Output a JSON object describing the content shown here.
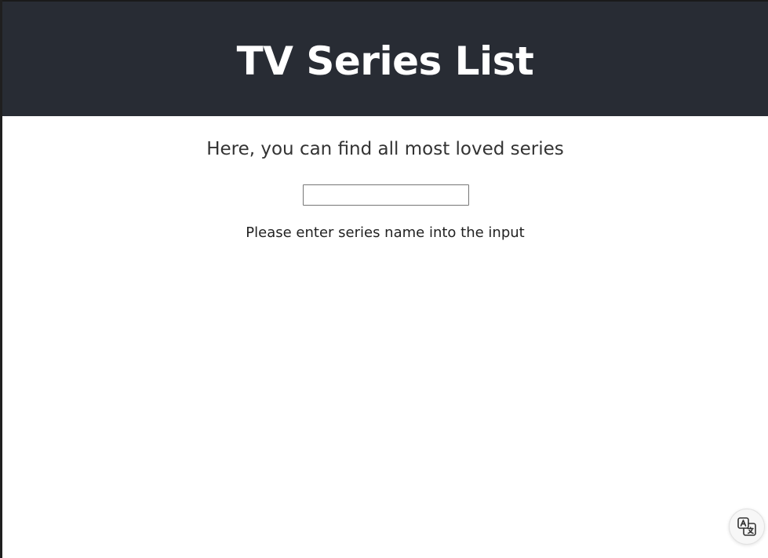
{
  "header": {
    "title": "TV Series List",
    "background_color": "#282c34"
  },
  "main": {
    "subtitle": "Here, you can find all most loved series",
    "search": {
      "value": "",
      "placeholder": ""
    },
    "hint": "Please enter series name into the input"
  },
  "overlay": {
    "translate_icon": "translate-icon"
  }
}
